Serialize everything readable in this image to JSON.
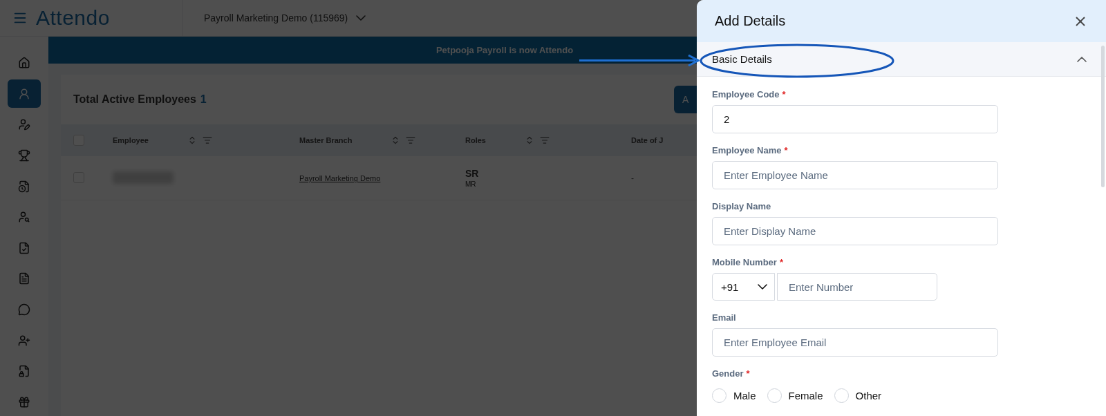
{
  "app": {
    "logo": "Attendo",
    "company": "Payroll Marketing Demo (115969)"
  },
  "sidebar": {
    "items": [
      {
        "kind": "home",
        "selected": false
      },
      {
        "kind": "user",
        "selected": true
      },
      {
        "kind": "user-edit",
        "selected": false
      },
      {
        "kind": "award",
        "selected": false
      },
      {
        "kind": "file-clock",
        "selected": false
      },
      {
        "kind": "person",
        "selected": false
      },
      {
        "kind": "file-check",
        "selected": false
      },
      {
        "kind": "file",
        "selected": false
      },
      {
        "kind": "chat",
        "selected": false
      },
      {
        "kind": "user-add",
        "selected": false
      },
      {
        "kind": "file-lock",
        "selected": false
      },
      {
        "kind": "gift",
        "selected": false
      }
    ]
  },
  "banner": "Petpooja Payroll is now Attendo",
  "employees": {
    "title": "Total Active Employees",
    "count": "1",
    "add_button": "A",
    "select_all": {
      "checked": false
    },
    "columns": [
      {
        "label": "Employee"
      },
      {
        "label": "Master Branch"
      },
      {
        "label": "Roles"
      },
      {
        "label": "Date of J"
      }
    ],
    "rows": [
      {
        "checked": false,
        "branch": "Payroll Marketing Demo",
        "role": "SR",
        "role_sub": "MR",
        "date": "-"
      }
    ]
  },
  "drawer": {
    "title": "Add Details",
    "section": {
      "title": "Basic Details",
      "expanded": true
    },
    "fields": [
      {
        "kind": "text",
        "label": "Employee Code",
        "mark": "*",
        "value": "2"
      },
      {
        "kind": "text",
        "label": "Employee Name",
        "mark": "*",
        "placeholder": "Enter Employee Name"
      },
      {
        "kind": "text",
        "label": "Display Name",
        "placeholder": "Enter Display Name"
      },
      {
        "kind": "phone",
        "label": "Mobile Number",
        "mark": "*",
        "code": "+91",
        "placeholder": "Enter Number"
      },
      {
        "kind": "text",
        "label": "Email",
        "placeholder": "Enter Employee Email"
      },
      {
        "kind": "radio",
        "label": "Gender",
        "mark": "*",
        "options": [
          {
            "label": "Male",
            "selected": false
          },
          {
            "label": "Female",
            "selected": false
          },
          {
            "label": "Other",
            "selected": false
          }
        ]
      }
    ]
  }
}
